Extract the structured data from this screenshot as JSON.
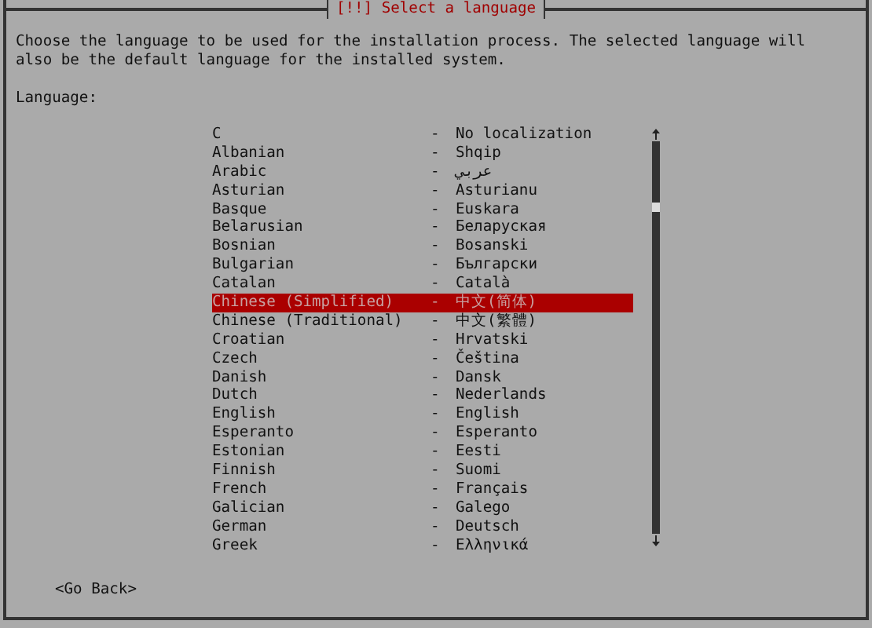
{
  "dialog": {
    "title": "[!!] Select a language",
    "description": "Choose the language to be used for the installation process. The selected language will also be the default language for the installed system.",
    "list_label": "Language:"
  },
  "languages": [
    {
      "name": "C",
      "separator": "-",
      "native": "No localization",
      "selected": false
    },
    {
      "name": "Albanian",
      "separator": "-",
      "native": "Shqip",
      "selected": false
    },
    {
      "name": "Arabic",
      "separator": "-",
      "native": "عربي",
      "selected": false
    },
    {
      "name": "Asturian",
      "separator": "-",
      "native": "Asturianu",
      "selected": false
    },
    {
      "name": "Basque",
      "separator": "-",
      "native": "Euskara",
      "selected": false
    },
    {
      "name": "Belarusian",
      "separator": "-",
      "native": "Беларуская",
      "selected": false
    },
    {
      "name": "Bosnian",
      "separator": "-",
      "native": "Bosanski",
      "selected": false
    },
    {
      "name": "Bulgarian",
      "separator": "-",
      "native": "Български",
      "selected": false
    },
    {
      "name": "Catalan",
      "separator": "-",
      "native": "Català",
      "selected": false
    },
    {
      "name": "Chinese (Simplified)",
      "separator": "-",
      "native": "中文(简体)",
      "selected": true
    },
    {
      "name": "Chinese (Traditional)",
      "separator": "-",
      "native": "中文(繁體)",
      "selected": false
    },
    {
      "name": "Croatian",
      "separator": "-",
      "native": "Hrvatski",
      "selected": false
    },
    {
      "name": "Czech",
      "separator": "-",
      "native": "Čeština",
      "selected": false
    },
    {
      "name": "Danish",
      "separator": "-",
      "native": "Dansk",
      "selected": false
    },
    {
      "name": "Dutch",
      "separator": "-",
      "native": "Nederlands",
      "selected": false
    },
    {
      "name": "English",
      "separator": "-",
      "native": "English",
      "selected": false
    },
    {
      "name": "Esperanto",
      "separator": "-",
      "native": "Esperanto",
      "selected": false
    },
    {
      "name": "Estonian",
      "separator": "-",
      "native": "Eesti",
      "selected": false
    },
    {
      "name": "Finnish",
      "separator": "-",
      "native": "Suomi",
      "selected": false
    },
    {
      "name": "French",
      "separator": "-",
      "native": "Français",
      "selected": false
    },
    {
      "name": "Galician",
      "separator": "-",
      "native": "Galego",
      "selected": false
    },
    {
      "name": "German",
      "separator": "-",
      "native": "Deutsch",
      "selected": false
    },
    {
      "name": "Greek",
      "separator": "-",
      "native": "Ελληνικά",
      "selected": false
    }
  ],
  "buttons": [
    {
      "label": "<Go Back>"
    }
  ]
}
